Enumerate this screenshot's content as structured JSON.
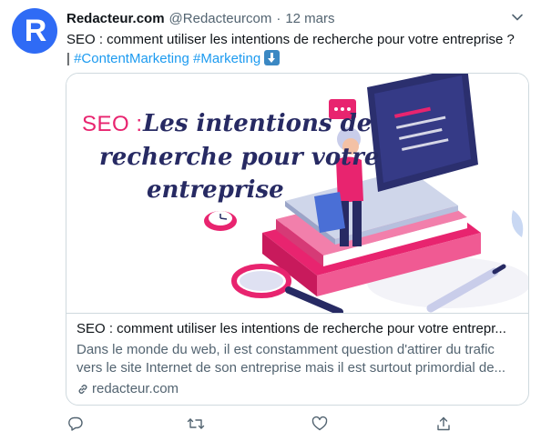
{
  "author": {
    "avatar_letter": "R",
    "name": "Redacteur.com",
    "handle": "@Redacteurcom",
    "separator": "·",
    "date": "12 mars"
  },
  "tweet": {
    "text": "SEO : comment utiliser les intentions de recherche pour votre entreprise ?",
    "pipe": "|",
    "hashtags": [
      "#ContentMarketing",
      "#Marketing"
    ],
    "emoji": "down-arrow-emoji"
  },
  "card": {
    "image_text": {
      "seo": "SEO :",
      "line1": "Les intentions de",
      "line2": "recherche pour votre",
      "line3": "entreprise"
    },
    "title": "SEO : comment utiliser les intentions de recherche pour votre entrepr...",
    "description_line1": "Dans le monde du web, il est constamment question d'attirer du trafic",
    "description_line2": "vers le site Internet de son entreprise mais il est surtout primordial de...",
    "domain": "redacteur.com"
  },
  "actions": {
    "icons": [
      "reply-icon",
      "retweet-icon",
      "like-icon",
      "share-icon"
    ]
  },
  "colors": {
    "accent": "#1d9bf0",
    "avatar_bg": "#2f6bf5",
    "brand_pink": "#e8246f",
    "navy": "#272a63",
    "muted": "#536471"
  }
}
